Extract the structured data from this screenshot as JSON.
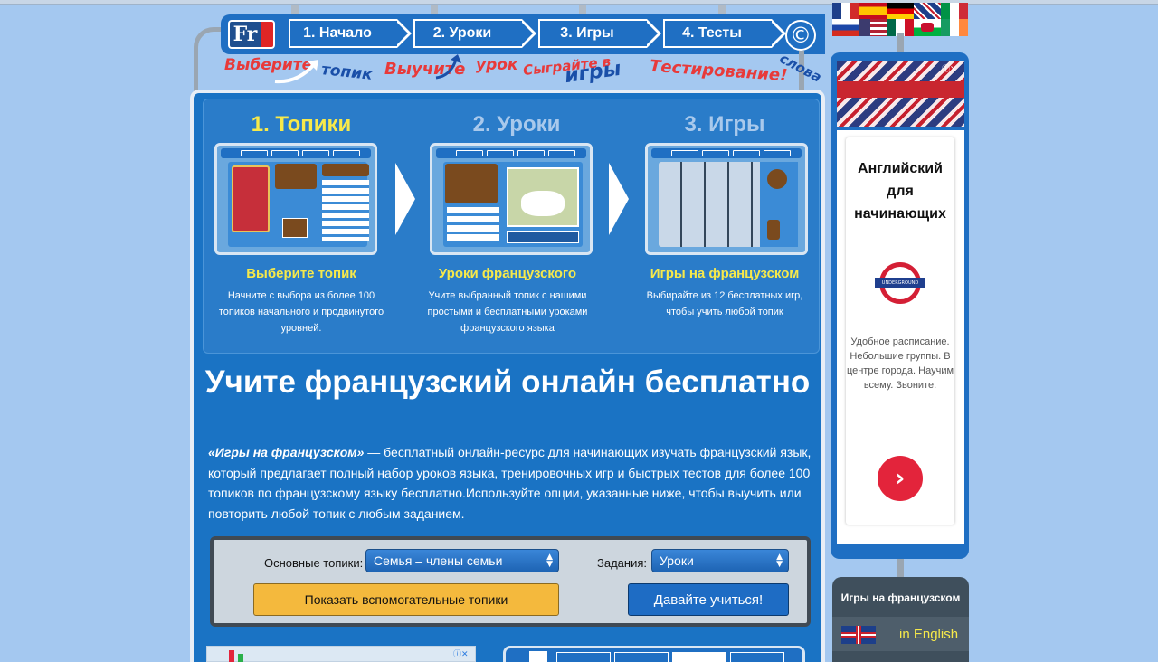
{
  "nav": {
    "logo": "Fr",
    "tabs": [
      "1. Начало",
      "2. Уроки",
      "3. Игры",
      "4. Тесты"
    ],
    "copyright": "©"
  },
  "sublabels": {
    "choose": "Выберите",
    "topic": "топик",
    "learn": "Выучите",
    "lesson": "урок",
    "play": "Сыграйте в",
    "games": "игры",
    "testing": "Тестирование!",
    "words": "слова"
  },
  "steps": [
    {
      "title": "1. Топики",
      "subtitle": "Выберите топик",
      "description": "Начните с выбора из более 100 топиков начального и продвинутого уровней.",
      "title_color": "#f7e94a"
    },
    {
      "title": "2. Уроки",
      "subtitle": "Уроки французского",
      "description": "Учите выбранный топик с нашими простыми и бесплатными уроками французского языка",
      "title_color": "#a9c9ec"
    },
    {
      "title": "3. Игры",
      "subtitle": "Игры на французском",
      "description": "Выбирайте из 12 бесплатных игр, чтобы учить любой топик",
      "title_color": "#a9c9ec"
    }
  ],
  "headline": "Учите французский онлайн бесплатно",
  "intro": {
    "lead": "«Игры на французском»",
    "text": " — бесплатный онлайн-ресурс для начинающих изучать французский язык, который предлагает полный набор уроков языка, тренировочных игр и быстрых тестов для более 100 топиков по французскому языку бесплатно.Используйте опции, указанные ниже, чтобы выучить или повторить любой топик с любым заданием."
  },
  "form": {
    "topics_label": "Основные топики:",
    "topics_value": "Семья – члены семьи",
    "tasks_label": "Задания:",
    "tasks_value": "Уроки",
    "show_button": "Показать вспомогательные топики",
    "go_button": "Давайте учиться!"
  },
  "side_ad": {
    "title": "Английский для начинающих",
    "logo_text": "UNDERGROUND",
    "text": "Удобное расписание. Небольшие группы. В центре города. Научим всему. Звоните.",
    "go": "›"
  },
  "lang_panel": {
    "title": "Игры на французском",
    "english": "in English"
  },
  "colors": {
    "accent_blue": "#1a73c4",
    "yellow": "#f7e94a",
    "button_yellow": "#f4b93d",
    "ad_red": "#e3243b"
  }
}
